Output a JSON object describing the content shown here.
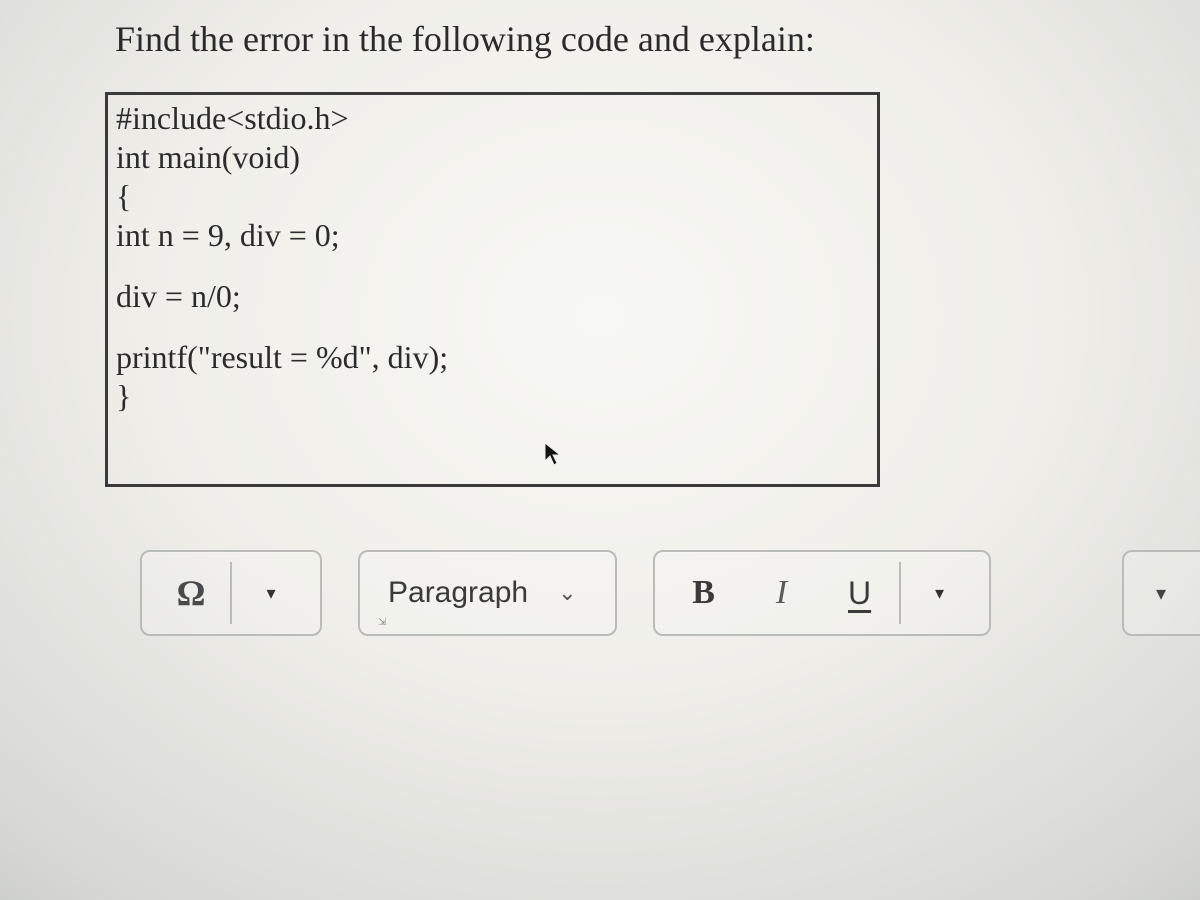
{
  "question": {
    "prompt": "Find the error in the following code and explain:",
    "code_lines": [
      "#include<stdio.h>",
      "int main(void)",
      "{",
      "int n = 9, div = 0;",
      "",
      "div = n/0;",
      "",
      "printf(\"result = %d\", div);",
      "}"
    ]
  },
  "toolbar": {
    "special_char_symbol": "Ω",
    "block_format": "Paragraph",
    "bold_label": "B",
    "italic_label": "I",
    "underline_label": "U"
  },
  "icons": {
    "dropdown_triangle": "▾",
    "chevron_down": "⌄"
  }
}
